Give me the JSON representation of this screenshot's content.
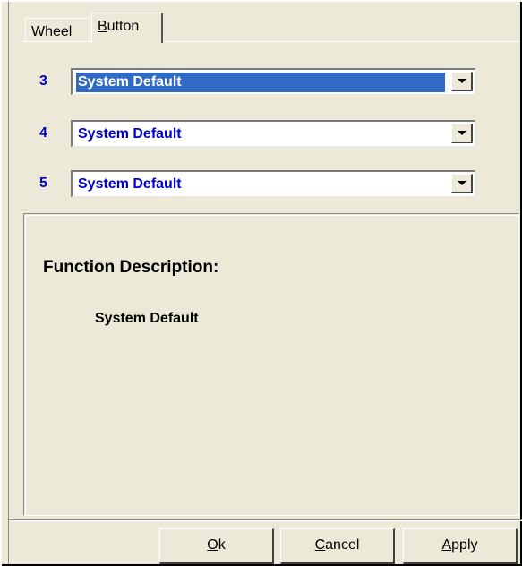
{
  "tabs": [
    {
      "label": "Wheel",
      "active": false
    },
    {
      "label_mnemonic": "B",
      "label_rest": "utton",
      "active": true
    }
  ],
  "buttons_mapping": [
    {
      "number": "3",
      "selected": "System Default",
      "focused": true
    },
    {
      "number": "4",
      "selected": "System Default",
      "focused": false
    },
    {
      "number": "5",
      "selected": "System Default",
      "focused": false
    }
  ],
  "description": {
    "heading": "Function Description:",
    "text": "System Default"
  },
  "footer": {
    "ok": {
      "mnemonic": "O",
      "rest": "k"
    },
    "cancel": {
      "mnemonic": "C",
      "rest": "ancel"
    },
    "apply": {
      "mnemonic": "A",
      "rest": "pply"
    }
  },
  "colors": {
    "dialog_bg": "#ece9d8",
    "label_blue": "#0000cc",
    "selection": "#316ac5"
  }
}
